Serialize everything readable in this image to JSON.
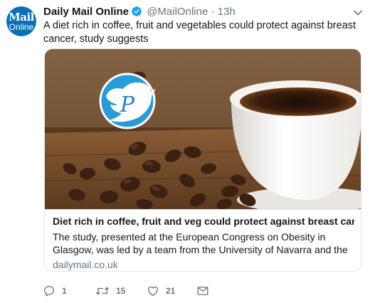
{
  "author": {
    "avatar_line1": "Mail",
    "avatar_line2": "Online",
    "name": "Daily Mail Online",
    "handle": "@MailOnline",
    "separator": "·",
    "time": "13h"
  },
  "tweet": {
    "text": "A diet rich in coffee, fruit and vegetables could protect against breast cancer, study suggests"
  },
  "card": {
    "title": "Diet rich in coffee, fruit and veg could protect against breast cancer",
    "description": "The study, presented at the European Congress on Obesity in Glasgow, was led by a team from the University of Navarra and the University of Jaen in ...",
    "domain": "dailymail.co.uk",
    "watermark_letter": "P"
  },
  "actions": {
    "replies": "1",
    "retweets": "15",
    "likes": "21"
  },
  "icons": {
    "verified": "verified-badge-icon",
    "caret": "chevron-down-icon",
    "reply": "reply-icon",
    "retweet": "retweet-icon",
    "like": "heart-icon",
    "message": "envelope-icon"
  },
  "colors": {
    "brand_avatar": "#0b6fb6",
    "verified": "#1da1f2",
    "secondary_text": "#657786",
    "border": "#e1e8ed"
  }
}
